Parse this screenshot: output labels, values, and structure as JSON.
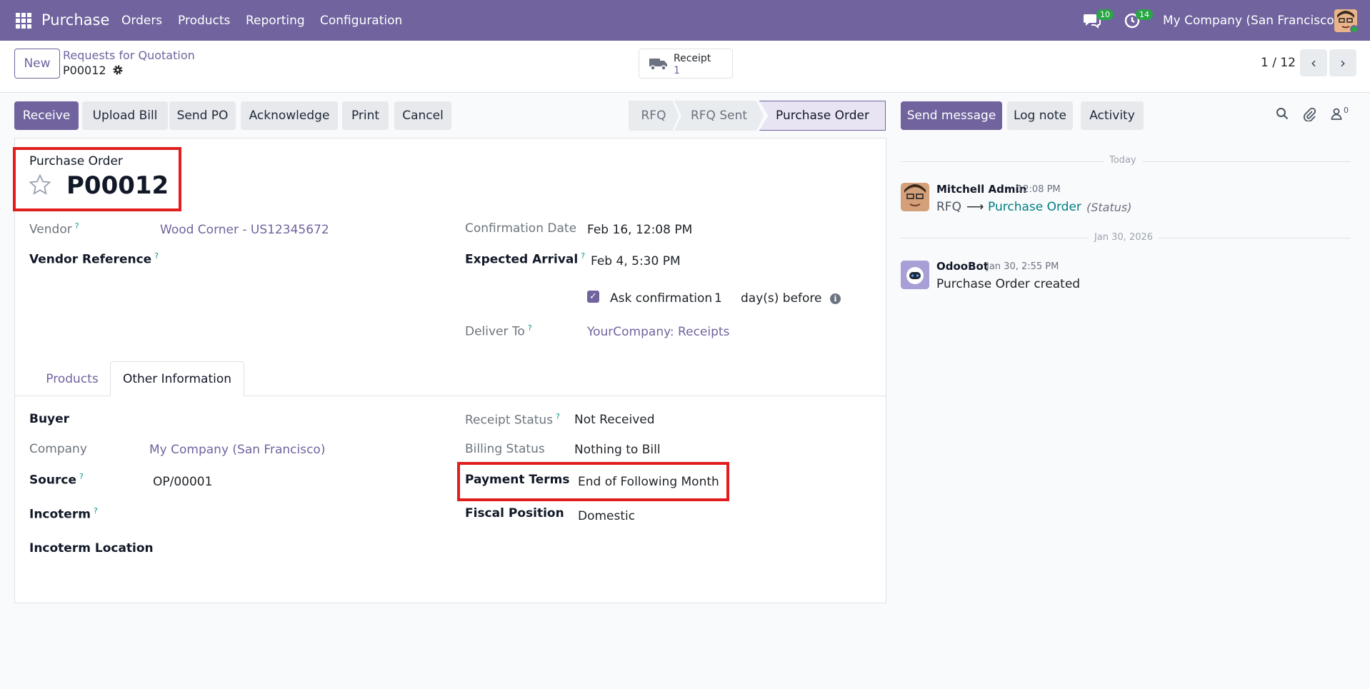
{
  "navbar": {
    "app_name": "Purchase",
    "menu": [
      "Orders",
      "Products",
      "Reporting",
      "Configuration"
    ],
    "messages_count": "10",
    "activities_count": "14",
    "company": "My Company (San Francisco)",
    "icons": [
      "apps-grid-icon",
      "chat-icon",
      "clock-icon",
      "user-avatar"
    ]
  },
  "control_panel": {
    "new_label": "New",
    "breadcrumb_parent": "Requests for Quotation",
    "breadcrumb_current": "P00012",
    "receipt_label": "Receipt",
    "receipt_count": "1",
    "pager": "1 / 12"
  },
  "actions": {
    "receive": "Receive",
    "upload_bill": "Upload Bill",
    "send_po": "Send PO",
    "acknowledge": "Acknowledge",
    "print": "Print",
    "cancel": "Cancel"
  },
  "stages": [
    "RFQ",
    "RFQ Sent",
    "Purchase Order"
  ],
  "form": {
    "doc_type": "Purchase Order",
    "name": "P00012",
    "vendor_label": "Vendor",
    "vendor_value": "Wood Corner - US12345672",
    "vendor_ref_label": "Vendor Reference",
    "confirmation_date_label": "Confirmation Date",
    "confirmation_date_value": "Feb 16, 12:08 PM",
    "expected_arrival_label": "Expected Arrival",
    "expected_arrival_value": "Feb 4, 5:30 PM",
    "ask_confirmation_label": "Ask confirmation",
    "ask_confirmation_days": "1",
    "ask_confirmation_suffix": "day(s) before",
    "deliver_to_label": "Deliver To",
    "deliver_to_value": "YourCompany: Receipts",
    "help_mark": "?",
    "info_mark": "i"
  },
  "tabs": [
    "Products",
    "Other Information"
  ],
  "other_info": {
    "buyer_label": "Buyer",
    "company_label": "Company",
    "company_value": "My Company (San Francisco)",
    "source_label": "Source",
    "source_value": "OP/00001",
    "incoterm_label": "Incoterm",
    "incoterm_location_label": "Incoterm Location",
    "receipt_status_label": "Receipt Status",
    "receipt_status_value": "Not Received",
    "billing_status_label": "Billing Status",
    "billing_status_value": "Nothing to Bill",
    "payment_terms_label": "Payment Terms",
    "payment_terms_value": "End of Following Month",
    "fiscal_position_label": "Fiscal Position",
    "fiscal_position_value": "Domestic"
  },
  "chatter": {
    "send_message": "Send message",
    "log_note": "Log note",
    "activity": "Activity",
    "followers_count": "0",
    "today_label": "Today",
    "date_label": "Jan 30, 2026",
    "messages": [
      {
        "author": "Mitchell Admin",
        "time": "12:08 PM",
        "from": "RFQ",
        "arrow": "⟶",
        "to": "Purchase Order",
        "field": "(Status)"
      },
      {
        "author": "OdooBot",
        "time": "Jan 30, 2:55 PM",
        "body": "Purchase Order created"
      }
    ]
  },
  "colors": {
    "brand": "#71639e",
    "highlight": "#e11d1d",
    "badge": "#28a745"
  }
}
